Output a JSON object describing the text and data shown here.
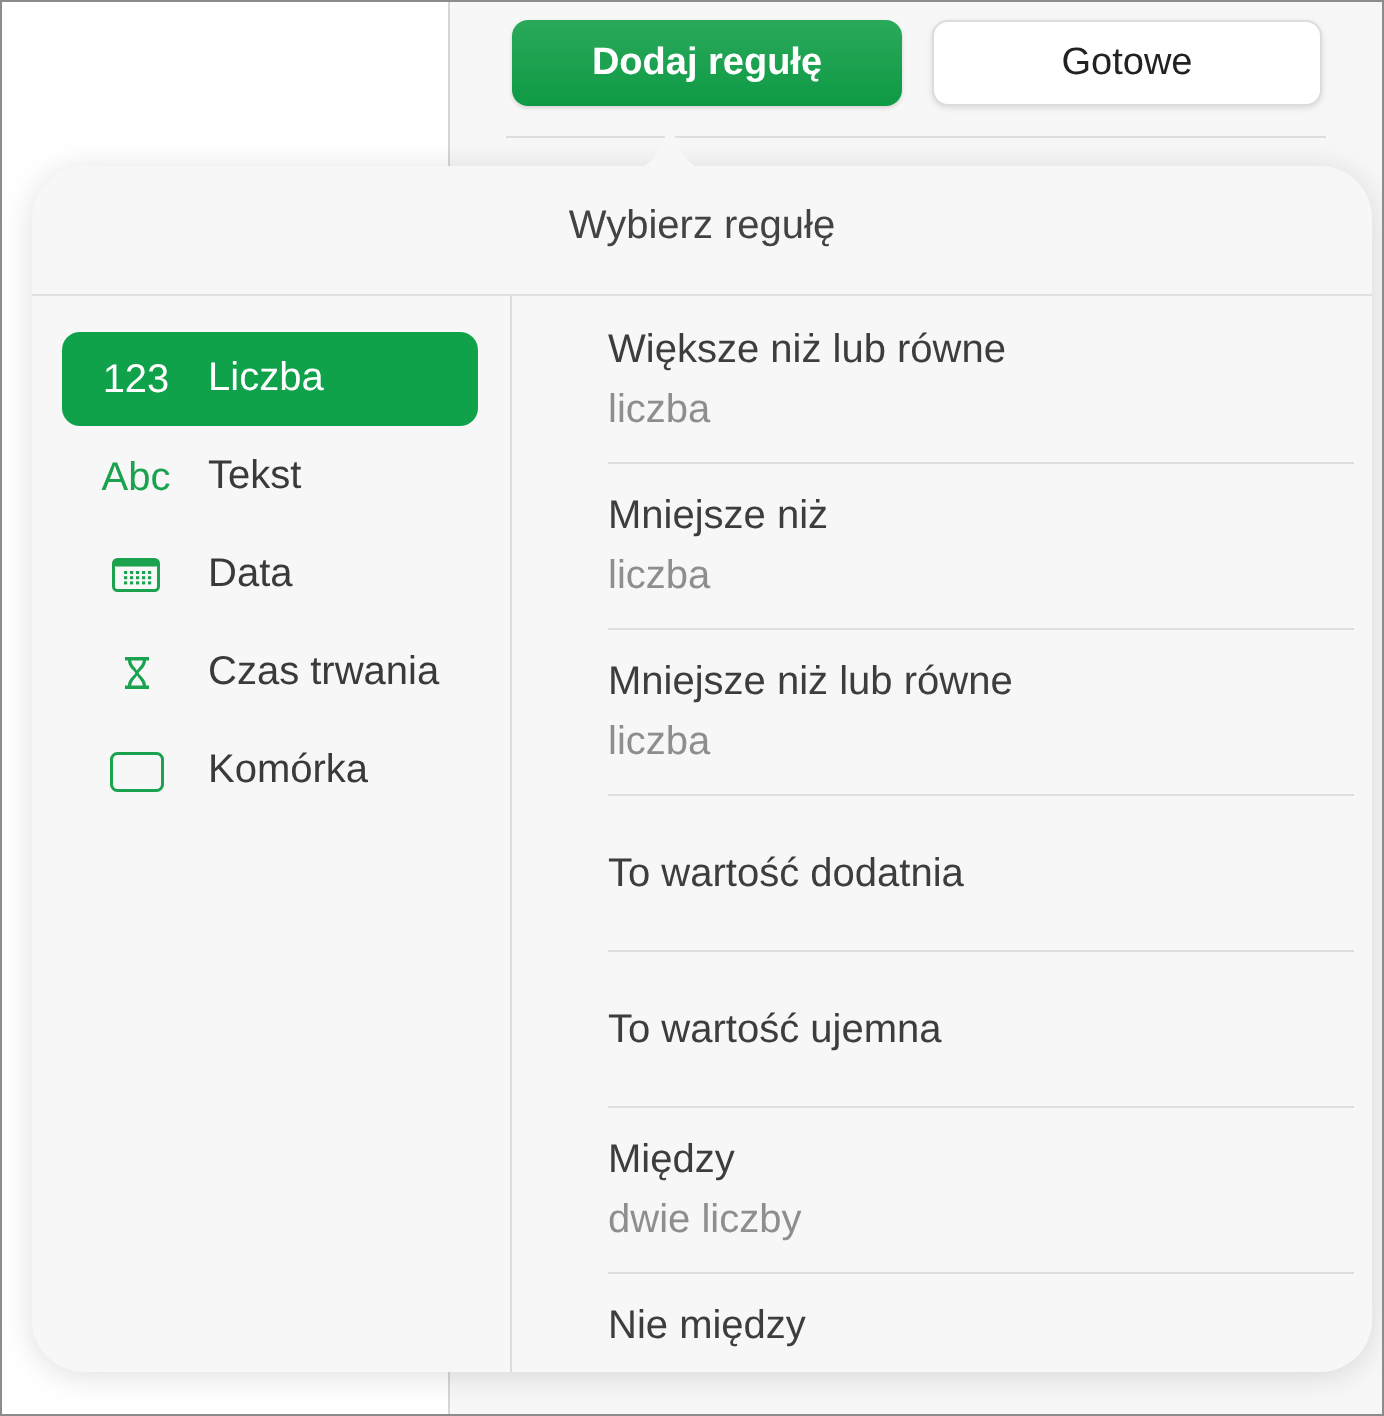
{
  "toolbar": {
    "buttons": [
      {
        "label": "Dodaj regułę",
        "kind": "primary"
      },
      {
        "label": "Gotowe",
        "kind": "secondary"
      }
    ]
  },
  "popover": {
    "title": "Wybierz regułę",
    "categories": [
      {
        "kind": "number",
        "glyph": "123",
        "label": "Liczba",
        "selected": true
      },
      {
        "kind": "text",
        "glyph": "Abc",
        "label": "Tekst",
        "selected": false
      },
      {
        "kind": "date",
        "label": "Data",
        "selected": false
      },
      {
        "kind": "duration",
        "label": "Czas trwania",
        "selected": false
      },
      {
        "kind": "cell",
        "label": "Komórka",
        "selected": false
      }
    ],
    "rules": [
      {
        "title": "Większe niż lub równe",
        "subtitle": "liczba"
      },
      {
        "title": "Mniejsze niż",
        "subtitle": "liczba"
      },
      {
        "title": "Mniejsze niż lub równe",
        "subtitle": "liczba"
      },
      {
        "title": "To wartość dodatnia"
      },
      {
        "title": "To wartość ujemna"
      },
      {
        "title": "Między",
        "subtitle": "dwie liczby"
      },
      {
        "title": "Nie między"
      }
    ]
  }
}
